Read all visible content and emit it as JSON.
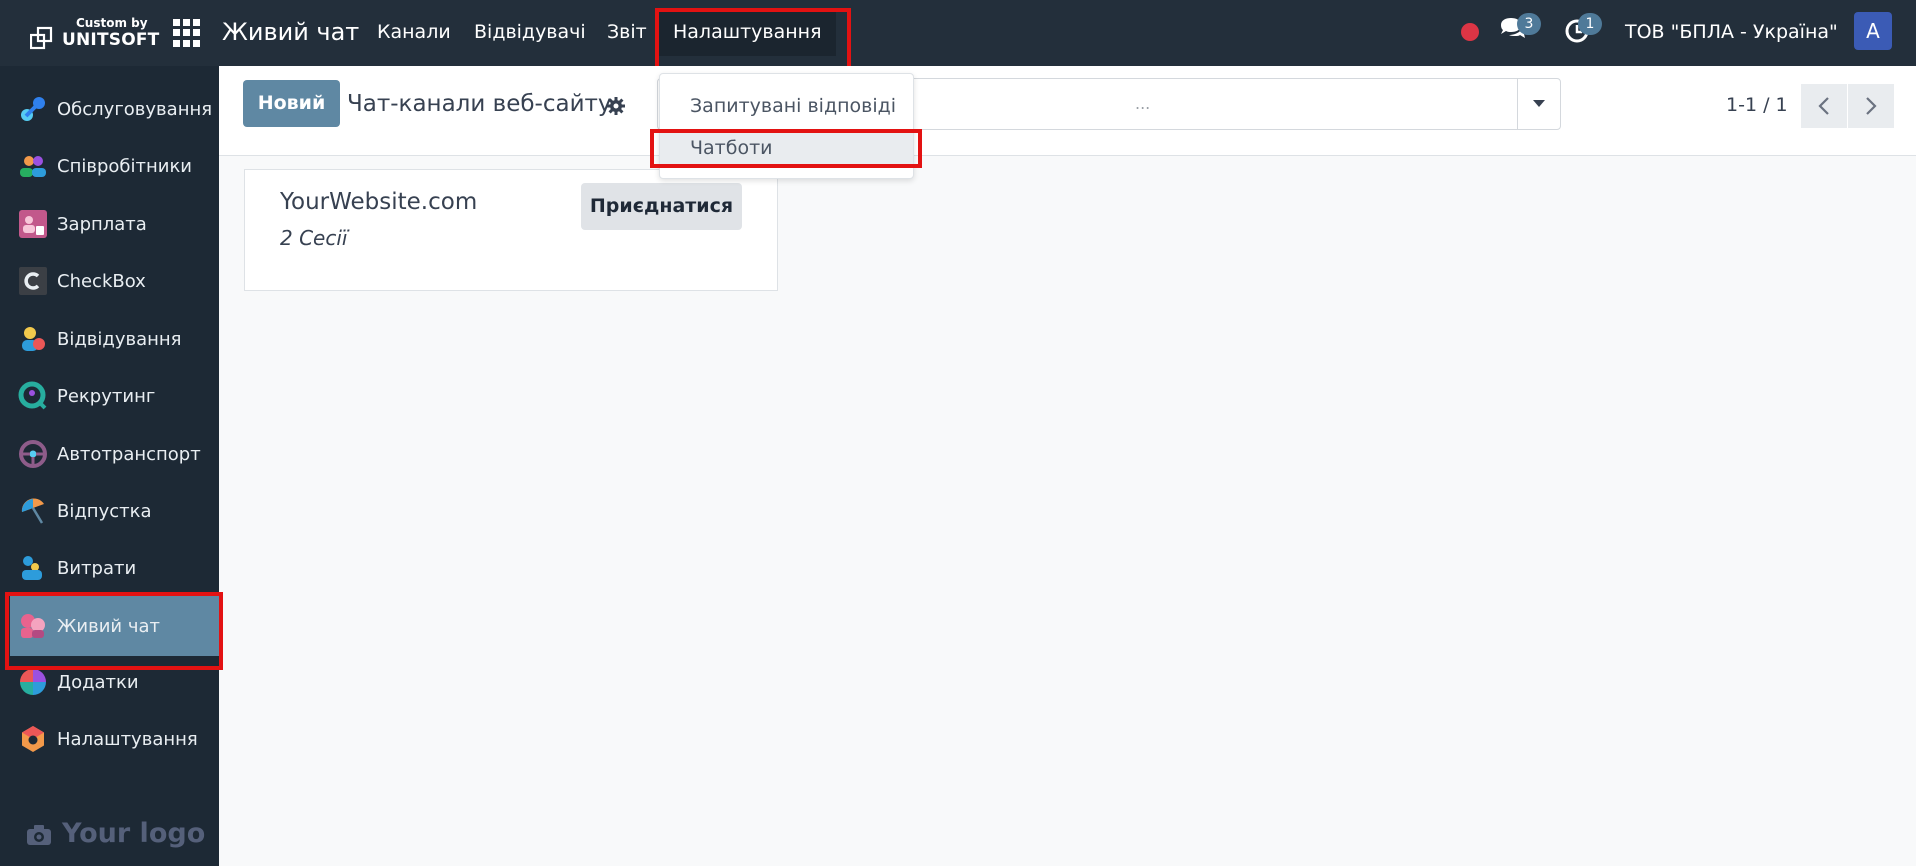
{
  "brand": {
    "top": "Custom by",
    "bottom": "UNITSOFT"
  },
  "navbar": {
    "app_title": "Живий чат",
    "menu": [
      "Канали",
      "Відвідувачі",
      "Звіт",
      "Налаштування"
    ],
    "chat_count": "3",
    "activity_count": "1",
    "company": "ТОВ \"БПЛА - Україна\"",
    "avatar_letter": "A"
  },
  "sidebar": {
    "items": [
      {
        "label": "Обслуговування",
        "icon": "wrench-icon",
        "color": "#2f80ed"
      },
      {
        "label": "Співробітники",
        "icon": "employees-icon",
        "color": "#f2994a"
      },
      {
        "label": "Зарплата",
        "icon": "payroll-icon",
        "color": "#c2588b"
      },
      {
        "label": "CheckBox",
        "icon": "checkbox-c-icon",
        "color": "#3b3f45"
      },
      {
        "label": "Відвідування",
        "icon": "attendance-icon",
        "color": "#f2c94c"
      },
      {
        "label": "Рекрутинг",
        "icon": "recruitment-icon",
        "color": "#27ae9f"
      },
      {
        "label": "Автотранспорт",
        "icon": "steering-wheel-icon",
        "color": "#8e5c8a"
      },
      {
        "label": "Відпустка",
        "icon": "umbrella-icon",
        "color": "#f2994a"
      },
      {
        "label": "Витрати",
        "icon": "expenses-icon",
        "color": "#2d9cdb"
      },
      {
        "label": "Живий чат",
        "icon": "live-chat-icon",
        "color": "#e8638e"
      },
      {
        "label": "Додатки",
        "icon": "apps-pie-icon",
        "color": "#eb5757"
      },
      {
        "label": "Налаштування",
        "icon": "settings-hex-icon",
        "color": "#f2994a"
      }
    ],
    "footer_logo": "Your logo"
  },
  "control": {
    "new_label": "Новий",
    "breadcrumb": "Чат-канали веб-сайту",
    "search_placeholder": "...",
    "pager": "1-1 / 1"
  },
  "dropdown": {
    "items": [
      "Запитувані відповіді",
      "Чатботи"
    ]
  },
  "card": {
    "title": "YourWebsite.com",
    "subtitle": "2 Сесії",
    "join_label": "Приєднатися"
  },
  "colors": {
    "navbar": "#232f3b",
    "sidebar": "#1d2935",
    "accent": "#5f88a3",
    "highlight": "#e31212"
  }
}
